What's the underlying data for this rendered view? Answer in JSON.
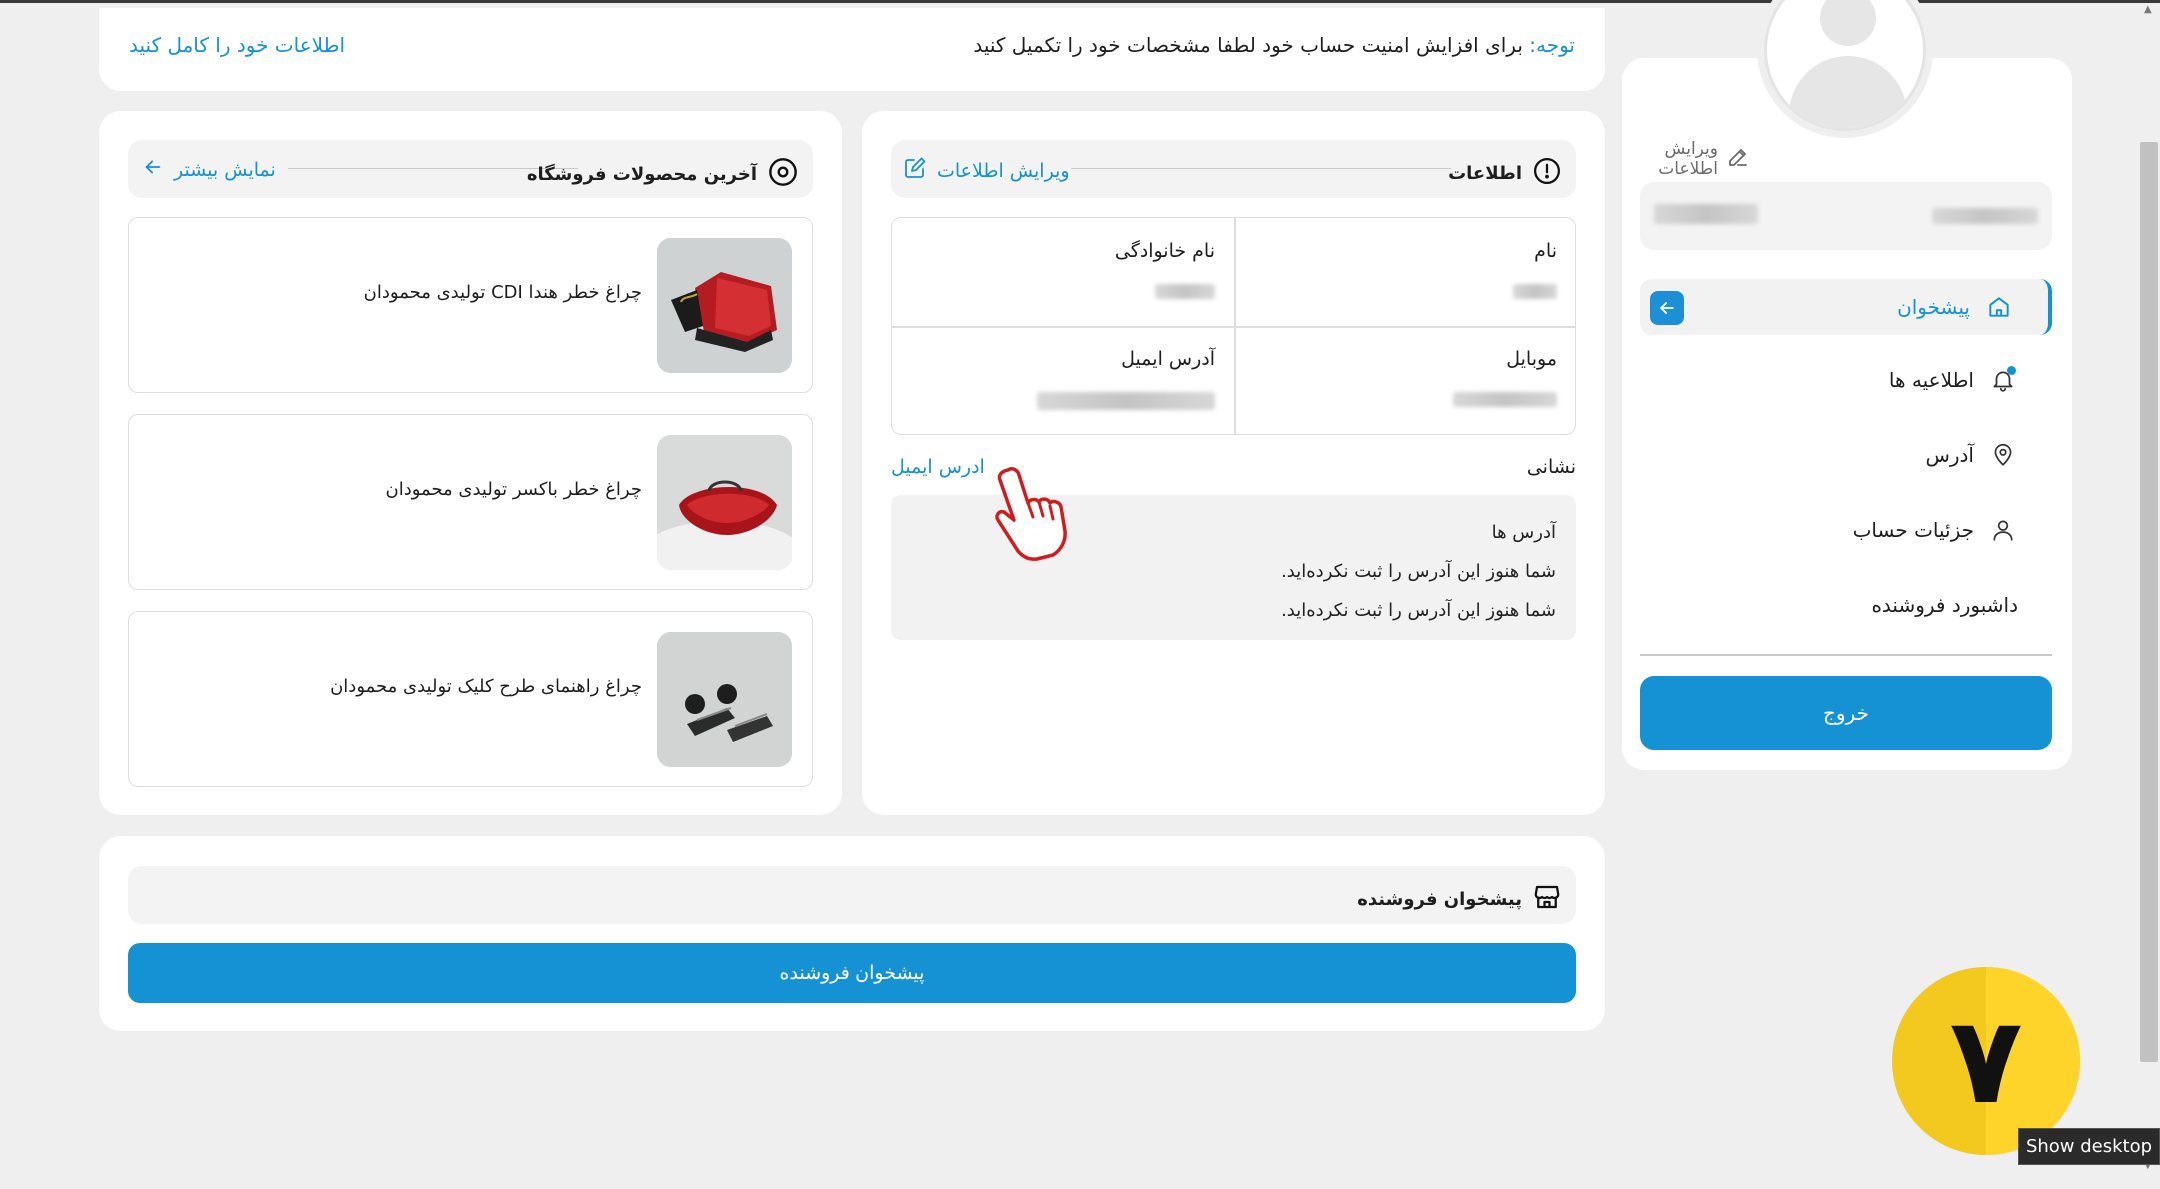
{
  "notice": {
    "prefix": "توجه:",
    "message": "برای افزایش امنیت حساب خود لطفا مشخصات خود را تکمیل کنید",
    "link": "اطلاعات خود را کامل کنید"
  },
  "sidebar": {
    "edit_label": "ویرایش اطلاعات",
    "items": [
      {
        "label": "پیشخوان",
        "icon": "home-icon"
      },
      {
        "label": "اطلاعیه ها",
        "icon": "bell-icon"
      },
      {
        "label": "آدرس",
        "icon": "location-pin-icon"
      },
      {
        "label": "جزئیات حساب",
        "icon": "user-icon"
      },
      {
        "label": "داشبورد فروشنده",
        "icon": ""
      }
    ],
    "logout_label": "خروج"
  },
  "info": {
    "title": "اطلاعات",
    "edit_link": "ویرایش اطلاعات",
    "fields": {
      "first_name_label": "نام",
      "last_name_label": "نام خانوادگی",
      "mobile_label": "موبایل",
      "email_label": "آدرس ایمیل"
    },
    "address_label": "نشانی",
    "address_link": "ادرس ایمیل",
    "address_heading": "آدرس ها",
    "address_lines": [
      "شما هنوز این آدرس را ثبت نکرده‌اید.",
      "شما هنوز این آدرس را ثبت نکرده‌اید."
    ]
  },
  "products": {
    "title": "آخرین محصولات فروشگاه",
    "more_link": "نمایش بیشتر",
    "items": [
      {
        "name": "چراغ خطر هندا CDI تولیدی محمودان"
      },
      {
        "name": "چراغ خطر باکسر تولیدی محمودان"
      },
      {
        "name": "چراغ راهنمای طرح کلیک تولیدی محمودان"
      }
    ]
  },
  "seller": {
    "title": "پیشخوان فروشنده",
    "button": "پیشخوان فروشنده"
  },
  "overlay": {
    "badge_number": "۷",
    "tooltip": "Show desktop"
  },
  "colors": {
    "accent": "#1492d3",
    "background": "#efefef",
    "badge": "#ffd42a"
  }
}
